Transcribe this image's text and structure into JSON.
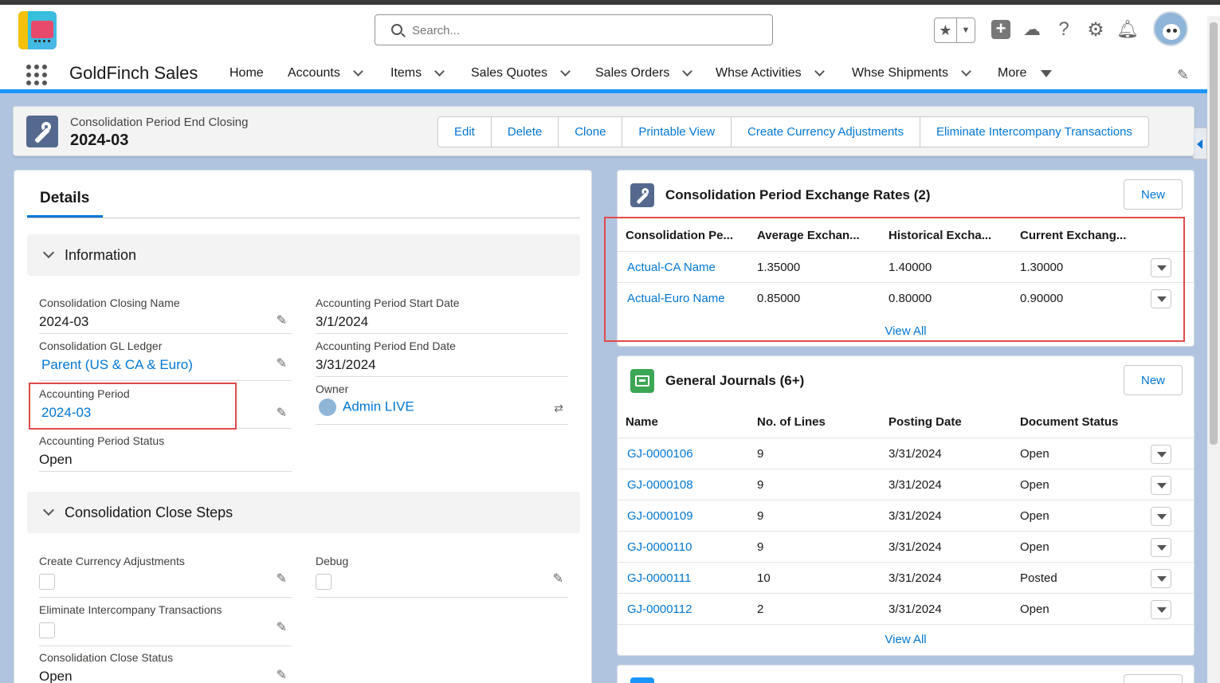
{
  "header": {
    "search_placeholder": "Search...",
    "icons": [
      "favorites-star-icon",
      "add-icon",
      "trailhead-icon",
      "help-icon",
      "setup-gear-icon",
      "notifications-bell-icon",
      "user-avatar"
    ]
  },
  "nav": {
    "app_name": "GoldFinch Sales",
    "items": [
      {
        "label": "Home"
      },
      {
        "label": "Accounts"
      },
      {
        "label": "Items"
      },
      {
        "label": "Sales Quotes"
      },
      {
        "label": "Sales Orders"
      },
      {
        "label": "Whse Activities"
      },
      {
        "label": "Whse Shipments"
      },
      {
        "label": "More"
      }
    ]
  },
  "record": {
    "type": "Consolidation Period End Closing",
    "name": "2024-03",
    "actions": [
      "Edit",
      "Delete",
      "Clone",
      "Printable View",
      "Create Currency Adjustments",
      "Eliminate Intercompany Transactions"
    ]
  },
  "details": {
    "tab": "Details",
    "information": {
      "title": "Information",
      "fields": {
        "closing_name_label": "Consolidation Closing Name",
        "closing_name_value": "2024-03",
        "gl_ledger_label": "Consolidation GL Ledger",
        "gl_ledger_value": "Parent (US & CA & Euro)",
        "acct_period_label": "Accounting Period",
        "acct_period_value": "2024-03",
        "acct_period_status_label": "Accounting Period Status",
        "acct_period_status_value": "Open",
        "start_date_label": "Accounting Period Start Date",
        "start_date_value": "3/1/2024",
        "end_date_label": "Accounting Period End Date",
        "end_date_value": "3/31/2024",
        "owner_label": "Owner",
        "owner_value": "Admin LIVE"
      }
    },
    "close_steps": {
      "title": "Consolidation Close Steps",
      "fields": {
        "create_currency_label": "Create Currency Adjustments",
        "create_currency_checked": false,
        "debug_label": "Debug",
        "debug_checked": false,
        "eliminate_label": "Eliminate Intercompany Transactions",
        "eliminate_checked": false,
        "close_status_label": "Consolidation Close Status",
        "close_status_value": "Open"
      }
    }
  },
  "exchange_rates": {
    "title": "Consolidation Period Exchange Rates (2)",
    "new_label": "New",
    "columns": [
      "Consolidation Pe...",
      "Average Exchan...",
      "Historical Excha...",
      "Current Exchang..."
    ],
    "rows": [
      {
        "name": "Actual-CA Name",
        "average": "1.35000",
        "historical": "1.40000",
        "current": "1.30000"
      },
      {
        "name": "Actual-Euro Name",
        "average": "0.85000",
        "historical": "0.80000",
        "current": "0.90000"
      }
    ],
    "view_all": "View All"
  },
  "general_journals": {
    "title": "General Journals (6+)",
    "new_label": "New",
    "columns": [
      "Name",
      "No. of Lines",
      "Posting Date",
      "Document Status"
    ],
    "rows": [
      {
        "name": "GJ-0000106",
        "lines": "9",
        "date": "3/31/2024",
        "status": "Open"
      },
      {
        "name": "GJ-0000108",
        "lines": "9",
        "date": "3/31/2024",
        "status": "Open"
      },
      {
        "name": "GJ-0000109",
        "lines": "9",
        "date": "3/31/2024",
        "status": "Open"
      },
      {
        "name": "GJ-0000110",
        "lines": "9",
        "date": "3/31/2024",
        "status": "Open"
      },
      {
        "name": "GJ-0000111",
        "lines": "10",
        "date": "3/31/2024",
        "status": "Posted"
      },
      {
        "name": "GJ-0000112",
        "lines": "2",
        "date": "3/31/2024",
        "status": "Open"
      }
    ],
    "view_all": "View All"
  },
  "colors": {
    "brand_blue": "#0176d3",
    "highlight_red": "#e04a4a",
    "page_bg": "#b0c4df"
  }
}
